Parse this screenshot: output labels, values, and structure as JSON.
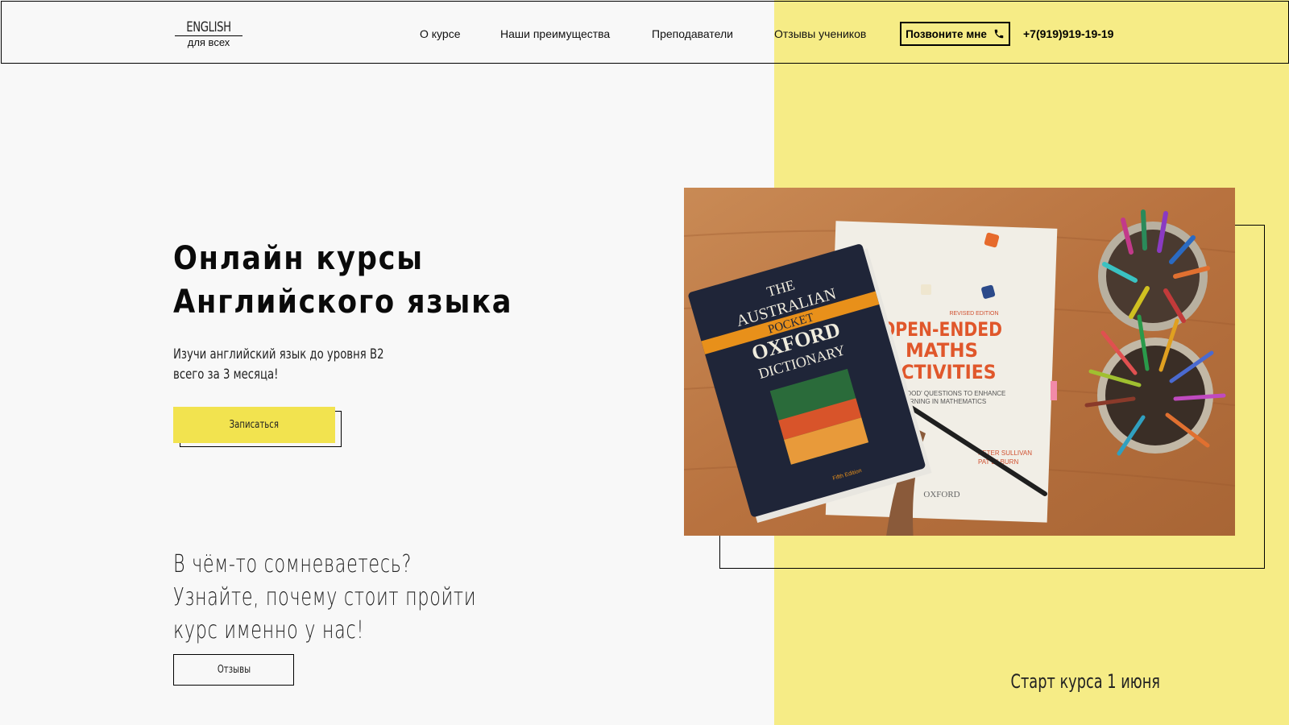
{
  "logo": {
    "top": "ENGLISH",
    "bottom": "для всех"
  },
  "nav": {
    "about": "О курсе",
    "advantages": "Наши преимущества",
    "teachers": "Преподаватели",
    "reviews": "Отзывы учеников"
  },
  "header": {
    "call_label": "Позвоните мне",
    "phone": "+7(919)919-19-19"
  },
  "hero": {
    "title_line1": "Онлайн курсы",
    "title_line2": "Английского языка",
    "sub_line1": "Изучи английский язык до уровня B2",
    "sub_line2": "всего за 3 месяца!",
    "enroll_label": "Записаться"
  },
  "doubt": {
    "line1": "В чём-то сомневаетесь?",
    "line2": "Узнайте, почему стоит пройти",
    "line3": "курс именно у нас!",
    "reviews_label": "Отзывы"
  },
  "start": "Старт курса 1 июня",
  "photo": {
    "dictionary_line1": "THE",
    "dictionary_line2": "AUSTRALIAN",
    "dictionary_line3": "POCKET",
    "dictionary_line4": "OXFORD",
    "dictionary_line5": "DICTIONARY",
    "dictionary_edition": "Fifth Edition",
    "book_edition": "REVISED EDITION",
    "book_line1": "OPEN-ENDED",
    "book_line2": "MATHS",
    "book_line3": "ACTIVITIES",
    "book_sub1": "USING 'GOOD' QUESTIONS TO ENHANCE",
    "book_sub2": "LEARNING IN MATHEMATICS",
    "book_author1": "PETER SULLIVAN",
    "book_author2": "PAT LILBURN",
    "book_publisher": "OXFORD"
  },
  "colors": {
    "yellow_panel": "#f6ec86",
    "button_yellow": "#f2e34f"
  }
}
